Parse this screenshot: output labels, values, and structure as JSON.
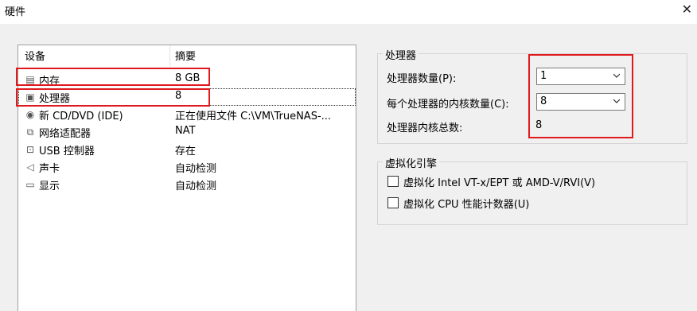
{
  "window": {
    "title": "硬件",
    "close_glyph": "✕"
  },
  "device_list": {
    "headers": {
      "device": "设备",
      "summary": "摘要"
    },
    "rows": [
      {
        "icon": "memory-icon",
        "glyph": "▤",
        "device": "内存",
        "summary": "8 GB"
      },
      {
        "icon": "processor-icon",
        "glyph": "▣",
        "device": "处理器",
        "summary": "8"
      },
      {
        "icon": "cd-dvd-icon",
        "glyph": "◉",
        "device": "新 CD/DVD (IDE)",
        "summary": "正在使用文件 C:\\VM\\TrueNAS-..."
      },
      {
        "icon": "network-adapter-icon",
        "glyph": "⧉",
        "device": "网络适配器",
        "summary": "NAT"
      },
      {
        "icon": "usb-icon",
        "glyph": "⊡",
        "device": "USB 控制器",
        "summary": "存在"
      },
      {
        "icon": "sound-card-icon",
        "glyph": "◁",
        "device": "声卡",
        "summary": "自动检测"
      },
      {
        "icon": "display-icon",
        "glyph": "▭",
        "device": "显示",
        "summary": "自动检测"
      }
    ],
    "selected_row": 1
  },
  "processor": {
    "group_title": "处理器",
    "count_label": "处理器数量(P):",
    "count_value": "1",
    "cores_label": "每个处理器的内核数量(C):",
    "cores_value": "8",
    "total_label": "处理器内核总数:",
    "total_value": "8"
  },
  "virtualization": {
    "group_title": "虚拟化引擎",
    "vtx_label": "虚拟化 Intel VT-x/EPT 或 AMD-V/RVI(V)",
    "vtx_checked": false,
    "cpu_counters_label": "虚拟化 CPU 性能计数器(U)",
    "cpu_counters_checked": false
  },
  "colors": {
    "highlight": "#e0191e",
    "background": "#f0f0f0"
  }
}
